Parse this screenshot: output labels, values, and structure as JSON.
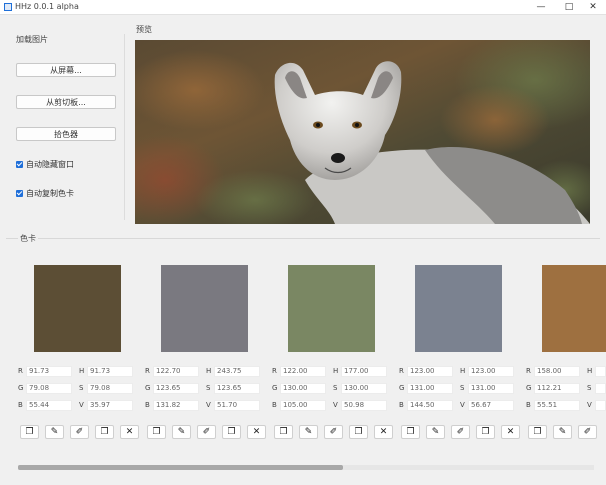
{
  "window": {
    "title": "HHz 0.0.1 alpha"
  },
  "sidebar": {
    "group_label": "加载图片",
    "from_screen": "从屏幕...",
    "from_clipboard": "从剪切板...",
    "color_picker": "拾色器",
    "auto_hide": "自动隐藏窗口",
    "auto_copy": "自动复制色卡"
  },
  "preview": {
    "label": "预览"
  },
  "palette": {
    "label": "色卡",
    "colors": [
      {
        "hex": "#5c4e35",
        "R": "91.73",
        "G": "79.08",
        "B": "55.44",
        "H": "91.73",
        "S": "79.08",
        "V": "35.97"
      },
      {
        "hex": "#7a7980",
        "R": "122.70",
        "G": "123.65",
        "B": "131.82",
        "H": "243.75",
        "S": "123.65",
        "V": "51.70"
      },
      {
        "hex": "#7a8763",
        "R": "122.00",
        "G": "130.00",
        "B": "105.00",
        "H": "177.00",
        "S": "130.00",
        "V": "50.98"
      },
      {
        "hex": "#7b8290",
        "R": "123.00",
        "G": "131.00",
        "B": "144.50",
        "H": "123.00",
        "S": "131.00",
        "V": "56.67"
      },
      {
        "hex": "#9e7040",
        "R": "158.00",
        "G": "112.21",
        "B": "55.51",
        "H": "",
        "S": "",
        "V": ""
      }
    ]
  },
  "icons": {
    "copy": "copy-icon",
    "edit": "pencil-icon",
    "pick": "eyedropper-icon",
    "duplicate": "duplicate-icon",
    "remove": "close-icon"
  }
}
